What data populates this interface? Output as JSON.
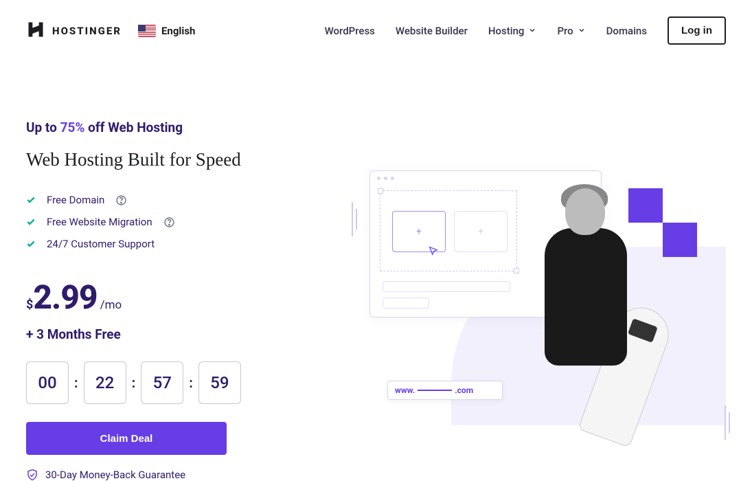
{
  "brand": {
    "name": "HOSTINGER"
  },
  "language": {
    "label": "English"
  },
  "nav": {
    "wordpress": "WordPress",
    "website_builder": "Website Builder",
    "hosting": "Hosting",
    "pro": "Pro",
    "domains": "Domains",
    "login": "Log in"
  },
  "hero": {
    "eyebrow_prefix": "Up to ",
    "eyebrow_pct": "75%",
    "eyebrow_suffix": " off Web Hosting",
    "headline": "Web Hosting Built for Speed",
    "features": {
      "f1": "Free Domain",
      "f2": "Free Website Migration",
      "f3": "24/7 Customer Support"
    },
    "price": {
      "currency": "$",
      "amount": "2.99",
      "period": "/mo"
    },
    "bonus": "+ 3 Months Free",
    "countdown": {
      "d": "00",
      "h": "22",
      "m": "57",
      "s": "59"
    },
    "cta": "Claim Deal",
    "guarantee": "30-Day Money-Back Guarantee"
  },
  "illustration": {
    "url_prefix": "www.",
    "url_suffix": ".com"
  }
}
